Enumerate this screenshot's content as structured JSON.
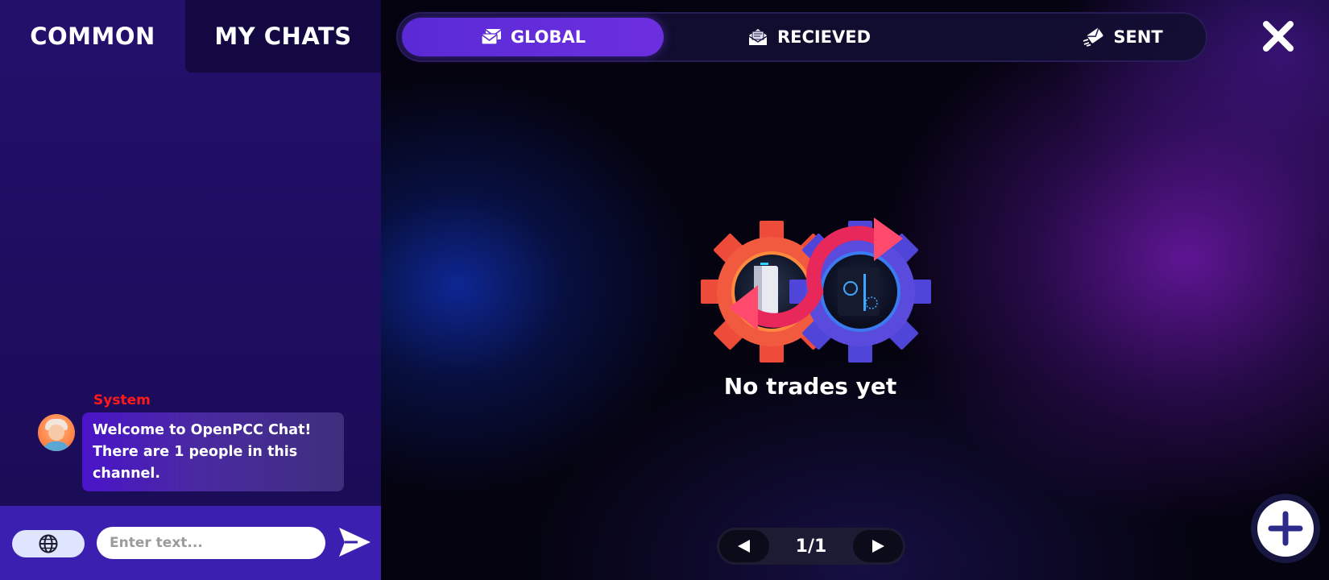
{
  "chat": {
    "tabs": [
      {
        "label": "COMMON",
        "active": true
      },
      {
        "label": "MY CHATS",
        "active": false
      }
    ],
    "messages": [
      {
        "sender": "System",
        "avatar_icon": "avatar-icon",
        "text": "Welcome to OpenPCC Chat! There are 1 people in this channel."
      }
    ],
    "input": {
      "placeholder": "Enter text...",
      "value": ""
    },
    "language_icon": "globe-icon",
    "send_icon": "send-icon",
    "colors": {
      "panel_bg": "#23106b",
      "input_bar_bg": "#3a1fb0",
      "sender_name": "#ff1a1a",
      "bubble_start": "#4a14c9"
    }
  },
  "trades": {
    "filters": [
      {
        "label": "GLOBAL",
        "icon": "envelopes-icon",
        "active": true
      },
      {
        "label": "RECIEVED",
        "icon": "open-envelope-icon",
        "active": false
      },
      {
        "label": "SENT",
        "icon": "flying-envelope-icon",
        "active": false
      }
    ],
    "empty_message": "No trades yet",
    "empty_icon": "trade-gears-icon",
    "pagination": {
      "current": 1,
      "total": 1,
      "label": "1/1"
    },
    "close_icon": "close-icon",
    "add_icon": "plus-icon",
    "colors": {
      "active_filter": "#5a2ad6",
      "gear_left": "#f4533e",
      "gear_right": "#5b4bdc",
      "arrow": "#e8275a"
    }
  }
}
